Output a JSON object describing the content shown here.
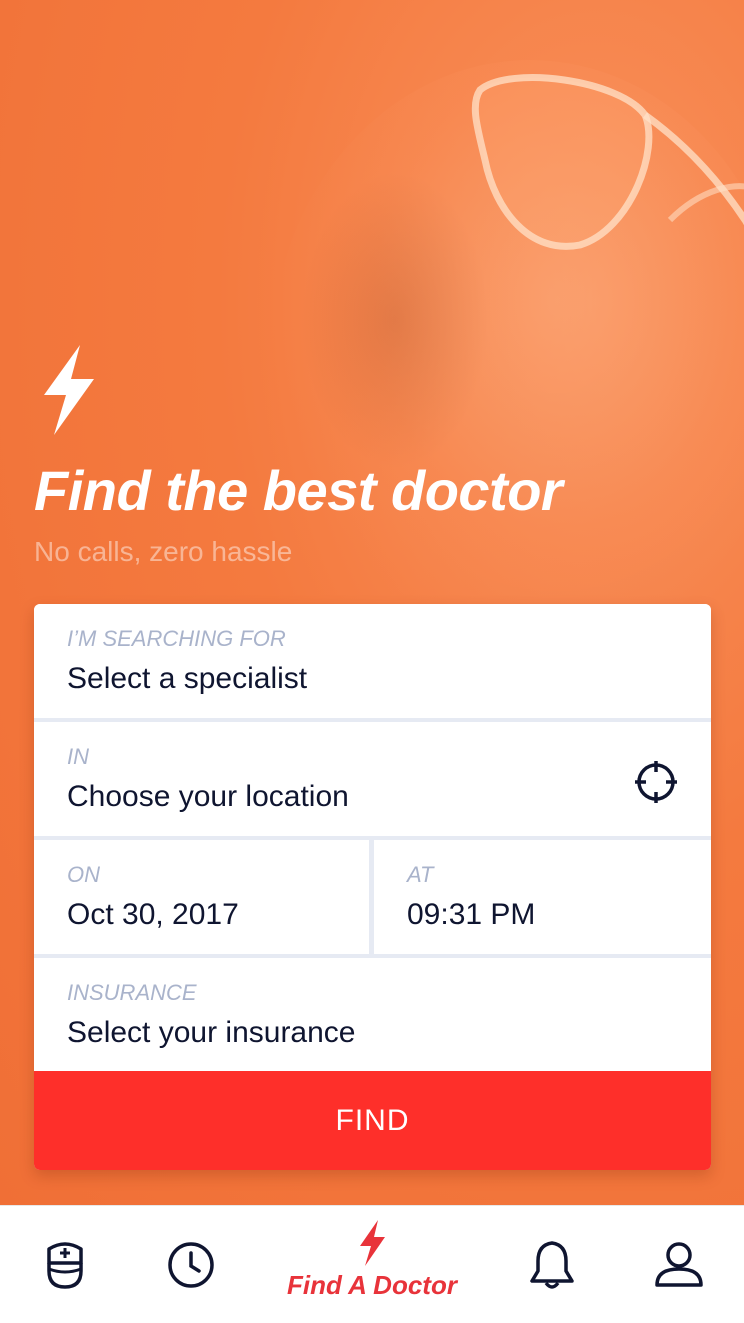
{
  "hero": {
    "headline": "Find the best doctor",
    "subline": "No calls, zero hassle"
  },
  "form": {
    "specialist": {
      "label": "I’M SEARCHING FOR",
      "value": "Select a specialist"
    },
    "location": {
      "label": "IN",
      "value": "Choose your location"
    },
    "date": {
      "label": "ON",
      "value": "Oct 30, 2017"
    },
    "time": {
      "label": "AT",
      "value": "09:31 PM"
    },
    "insurance": {
      "label": "INSURANCE",
      "value": "Select your insurance"
    },
    "find_label": "FIND"
  },
  "tabbar": {
    "items": [
      {
        "icon": "nurse-icon",
        "label": ""
      },
      {
        "icon": "clock-icon",
        "label": ""
      },
      {
        "icon": "bolt-icon",
        "label": "Find A Doctor",
        "active": true
      },
      {
        "icon": "bell-icon",
        "label": ""
      },
      {
        "icon": "user-icon",
        "label": ""
      }
    ]
  },
  "colors": {
    "brand_orange": "#f47a3f",
    "find_button": "#fe2f2a",
    "active_tab": "#e8333a",
    "label_gray": "#a9b3cb",
    "value_dark": "#0f1530"
  }
}
